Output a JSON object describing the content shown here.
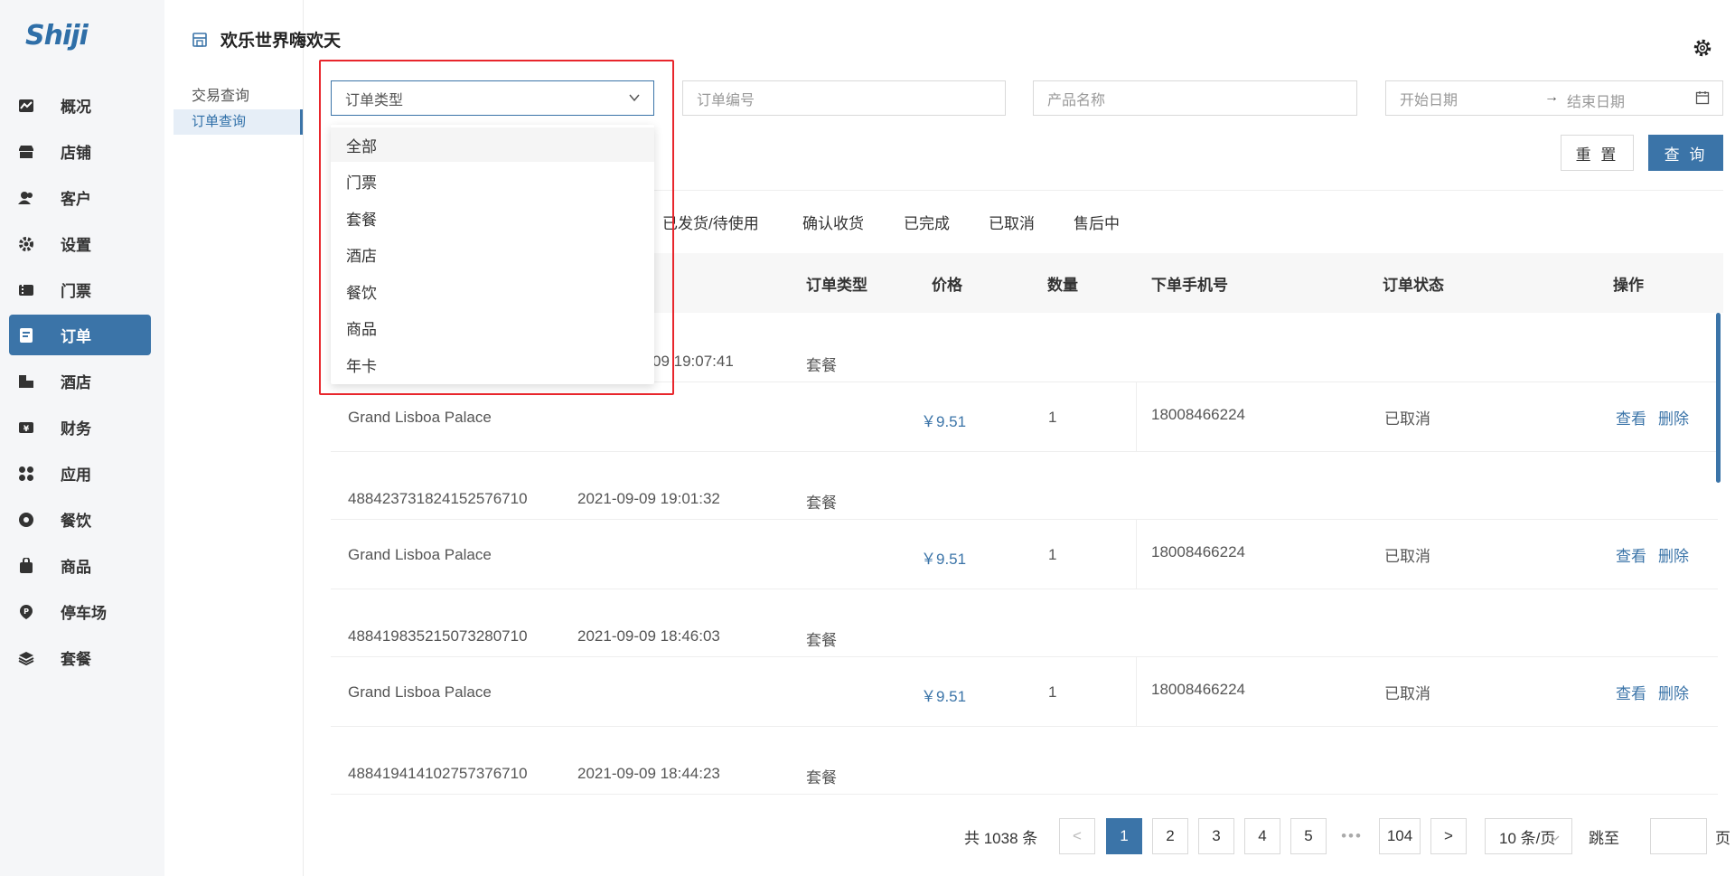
{
  "app": {
    "logo": "Shiji"
  },
  "nav": {
    "items": [
      {
        "label": "概况",
        "icon": "chart-icon"
      },
      {
        "label": "店铺",
        "icon": "shop-icon"
      },
      {
        "label": "客户",
        "icon": "users-icon"
      },
      {
        "label": "设置",
        "icon": "gear-icon"
      },
      {
        "label": "门票",
        "icon": "ticket-icon"
      },
      {
        "label": "订单",
        "icon": "order-icon",
        "active": true
      },
      {
        "label": "酒店",
        "icon": "hotel-icon"
      },
      {
        "label": "财务",
        "icon": "finance-icon"
      },
      {
        "label": "应用",
        "icon": "apps-icon"
      },
      {
        "label": "餐饮",
        "icon": "dining-icon"
      },
      {
        "label": "商品",
        "icon": "bag-icon"
      },
      {
        "label": "停车场",
        "icon": "parking-icon"
      },
      {
        "label": "套餐",
        "icon": "layers-icon"
      }
    ]
  },
  "store": {
    "name": "欢乐世界嗨欢天"
  },
  "subnav": {
    "title": "交易查询",
    "active_item": "订单查询"
  },
  "filters": {
    "order_type": {
      "placeholder": "订单类型"
    },
    "order_no": {
      "placeholder": "订单编号"
    },
    "product": {
      "placeholder": "产品名称"
    },
    "start_date": {
      "placeholder": "开始日期"
    },
    "date_sep": "→",
    "end_date": {
      "placeholder": "结束日期"
    },
    "reset_label": "重 置",
    "query_label": "查 询"
  },
  "status_tabs": [
    "已发货/待使用",
    "确认收货",
    "已完成",
    "已取消",
    "售后中"
  ],
  "table": {
    "headers": {
      "type": "订单类型",
      "price": "价格",
      "qty": "数量",
      "phone": "下单手机号",
      "status": "订单状态",
      "action": "操作"
    },
    "first_partial_time": "09 19:07:41",
    "first_partial_type": "套餐",
    "rows": [
      {
        "product": "Grand Lisboa Palace",
        "price": "￥9.51",
        "qty": "1",
        "phone": "18008466224",
        "status": "已取消",
        "view": "查看",
        "delete": "删除"
      },
      {
        "order_no": "488423731824152576710",
        "time": "2021-09-09 19:01:32",
        "type": "套餐",
        "product": "Grand Lisboa Palace",
        "price": "￥9.51",
        "qty": "1",
        "phone": "18008466224",
        "status": "已取消",
        "view": "查看",
        "delete": "删除"
      },
      {
        "order_no": "488419835215073280710",
        "time": "2021-09-09 18:46:03",
        "type": "套餐",
        "product": "Grand Lisboa Palace",
        "price": "￥9.51",
        "qty": "1",
        "phone": "18008466224",
        "status": "已取消",
        "view": "查看",
        "delete": "删除"
      },
      {
        "order_no": "488419414102757376710",
        "time": "2021-09-09 18:44:23",
        "type": "套餐"
      }
    ]
  },
  "pagination": {
    "total": "共 1038 条",
    "prev": "<",
    "pages": [
      "1",
      "2",
      "3",
      "4",
      "5"
    ],
    "current": "1",
    "ellipsis": "•••",
    "last": "104",
    "next": ">",
    "page_size": "10 条/页",
    "jump_label": "跳至",
    "page_suffix": "页"
  },
  "dropdown": {
    "options": [
      "全部",
      "门票",
      "套餐",
      "酒店",
      "餐饮",
      "商品",
      "年卡"
    ],
    "highlighted": "全部"
  },
  "colors": {
    "accent": "#3b74a8",
    "highlight_box": "#e8262c"
  }
}
